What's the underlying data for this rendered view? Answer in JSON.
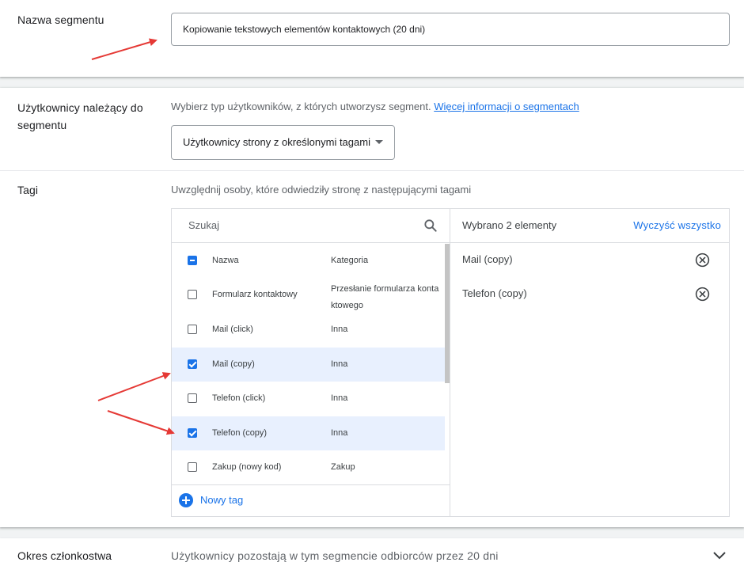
{
  "segment_name": {
    "label": "Nazwa segmentu",
    "value": "Kopiowanie tekstowych elementów kontaktowych (20 dni)"
  },
  "users": {
    "label": "Użytkownicy należący do segmentu",
    "description": "Wybierz typ użytkowników, z których utworzysz segment.",
    "link": "Więcej informacji o segmentach",
    "dropdown_value": "Użytkownicy strony z określonymi tagami"
  },
  "tags": {
    "label": "Tagi",
    "description": "Uwzględnij osoby, które odwiedziły stronę z następującymi tagami",
    "search_placeholder": "Szukaj",
    "header": {
      "name": "Nazwa",
      "category": "Kategoria"
    },
    "rows": [
      {
        "name": "Formularz kontaktowy",
        "category": "Przesłanie formularza konta ktowego",
        "checked": false
      },
      {
        "name": "Mail (click)",
        "category": "Inna",
        "checked": false
      },
      {
        "name": "Mail (copy)",
        "category": "Inna",
        "checked": true
      },
      {
        "name": "Telefon (click)",
        "category": "Inna",
        "checked": false
      },
      {
        "name": "Telefon (copy)",
        "category": "Inna",
        "checked": true
      },
      {
        "name": "Zakup (nowy kod)",
        "category": "Zakup",
        "checked": false
      }
    ],
    "new_tag": "Nowy tag",
    "selected_count": "Wybrano 2 elementy",
    "clear_all": "Wyczyść wszystko",
    "selected": [
      "Mail (copy)",
      "Telefon (copy)"
    ]
  },
  "membership": {
    "label": "Okres członkostwa",
    "description": "Użytkownicy pozostają w tym segmencie odbiorców przez 20 dni"
  },
  "colors": {
    "accent": "#1a73e8",
    "annotation": "#e53935",
    "selected_row": "#e8f0fe"
  }
}
